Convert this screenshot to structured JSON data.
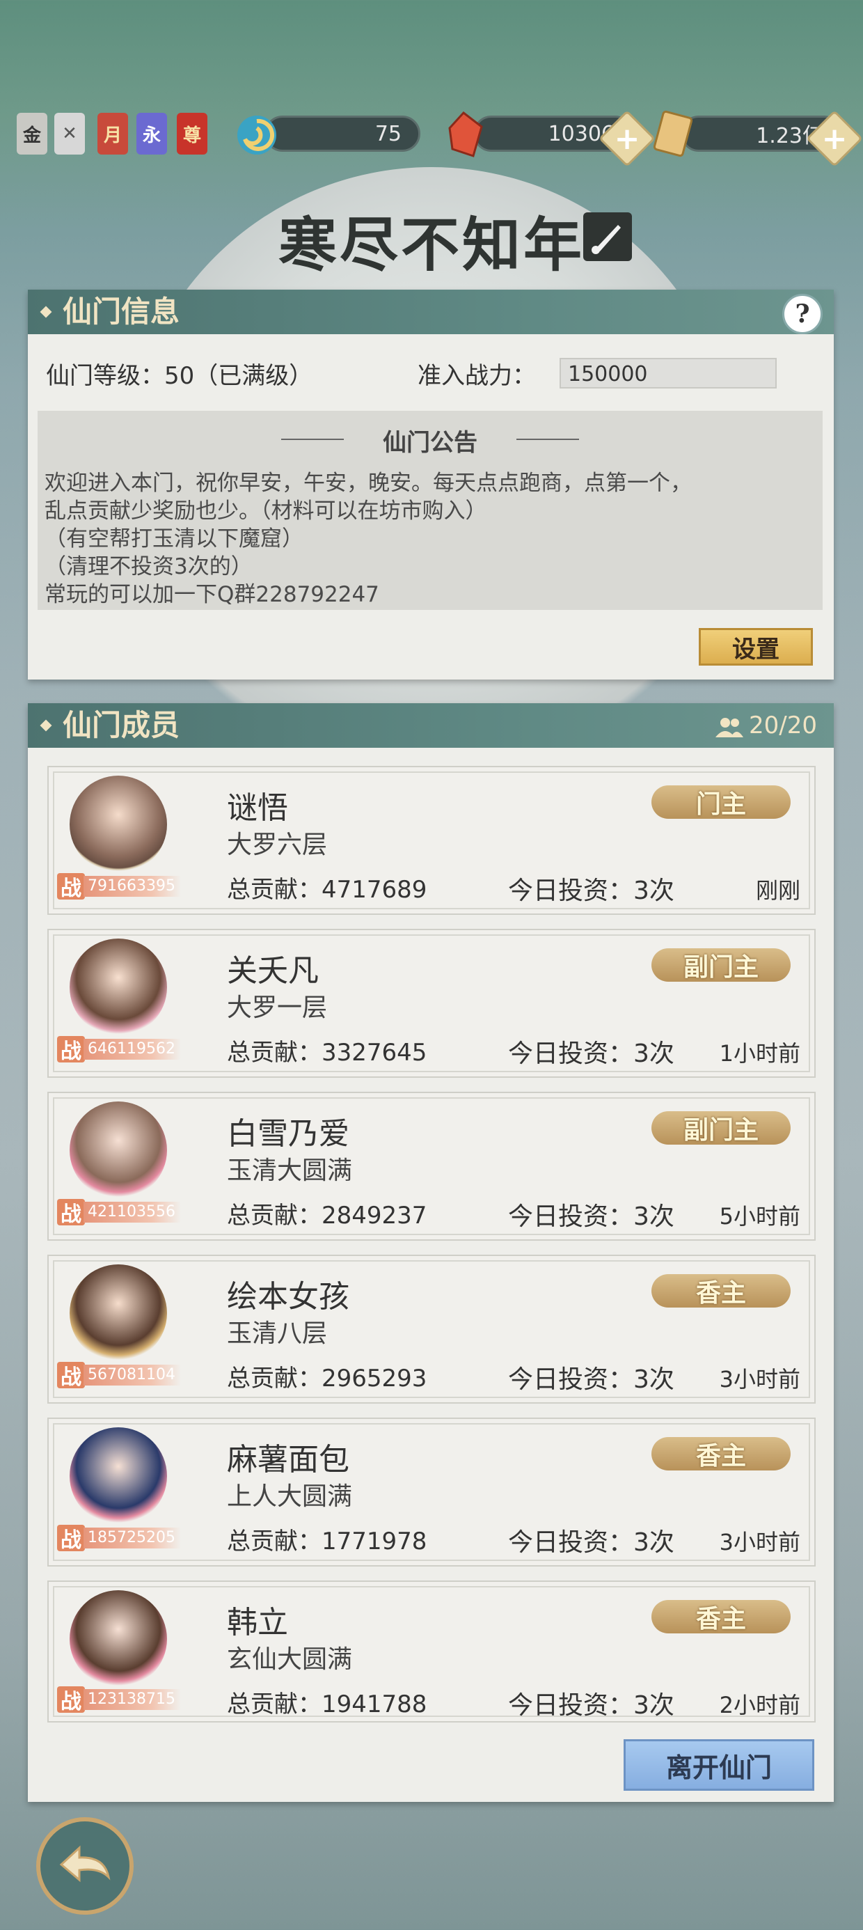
{
  "topbar": {
    "badges": [
      "金",
      "✕",
      "月",
      "永",
      "尊"
    ],
    "resources": [
      {
        "icon": "spirit-swirl-icon",
        "value": "75"
      },
      {
        "icon": "red-crystal-icon",
        "value": "10306"
      },
      {
        "icon": "scroll-icon",
        "value": "1.23亿"
      }
    ],
    "plus": "+"
  },
  "sect_name": "寒尽不知年",
  "info": {
    "header": "仙门信息",
    "help": "?",
    "level_label": "仙门等级：50（已满级）",
    "power_label": "准入战力：",
    "power_value": "150000",
    "notice_title": "仙门公告",
    "notice_text": "欢迎进入本门，祝你早安，午安，晚安。每天点点跑商，点第一个，\n乱点贡献少奖励也少。（材料可以在坊市购入）\n（有空帮打玉清以下魔窟）\n（清理不投资3次的）\n常玩的可以加一下Q群228792247",
    "settings_button": "设置"
  },
  "members": {
    "header": "仙门成员",
    "count": "20/20",
    "list": [
      {
        "name": "谜悟",
        "realm": "大罗六层",
        "contribution": "总贡献：4717689",
        "invest": "今日投资：3次",
        "time": "刚刚",
        "rank": "门主",
        "power": "791663395",
        "zhan": "战"
      },
      {
        "name": "关夭凡",
        "realm": "大罗一层",
        "contribution": "总贡献：3327645",
        "invest": "今日投资：3次",
        "time": "1小时前",
        "rank": "副门主",
        "power": "646119562",
        "zhan": "战"
      },
      {
        "name": "白雪乃爱",
        "realm": "玉清大圆满",
        "contribution": "总贡献：2849237",
        "invest": "今日投资：3次",
        "time": "5小时前",
        "rank": "副门主",
        "power": "421103556",
        "zhan": "战"
      },
      {
        "name": "绘本女孩",
        "realm": "玉清八层",
        "contribution": "总贡献：2965293",
        "invest": "今日投资：3次",
        "time": "3小时前",
        "rank": "香主",
        "power": "567081104",
        "zhan": "战"
      },
      {
        "name": "麻薯面包",
        "realm": "上人大圆满",
        "contribution": "总贡献：1771978",
        "invest": "今日投资：3次",
        "time": "3小时前",
        "rank": "香主",
        "power": "185725205",
        "zhan": "战"
      },
      {
        "name": "韩立",
        "realm": "玄仙大圆满",
        "contribution": "总贡献：1941788",
        "invest": "今日投资：3次",
        "time": "2小时前",
        "rank": "香主",
        "power": "123138715",
        "zhan": "战"
      }
    ],
    "leave_button": "离开仙门"
  },
  "colors": {
    "accent": "#5f8984",
    "gold": "#dcae4f",
    "leave": "#86aee0"
  }
}
